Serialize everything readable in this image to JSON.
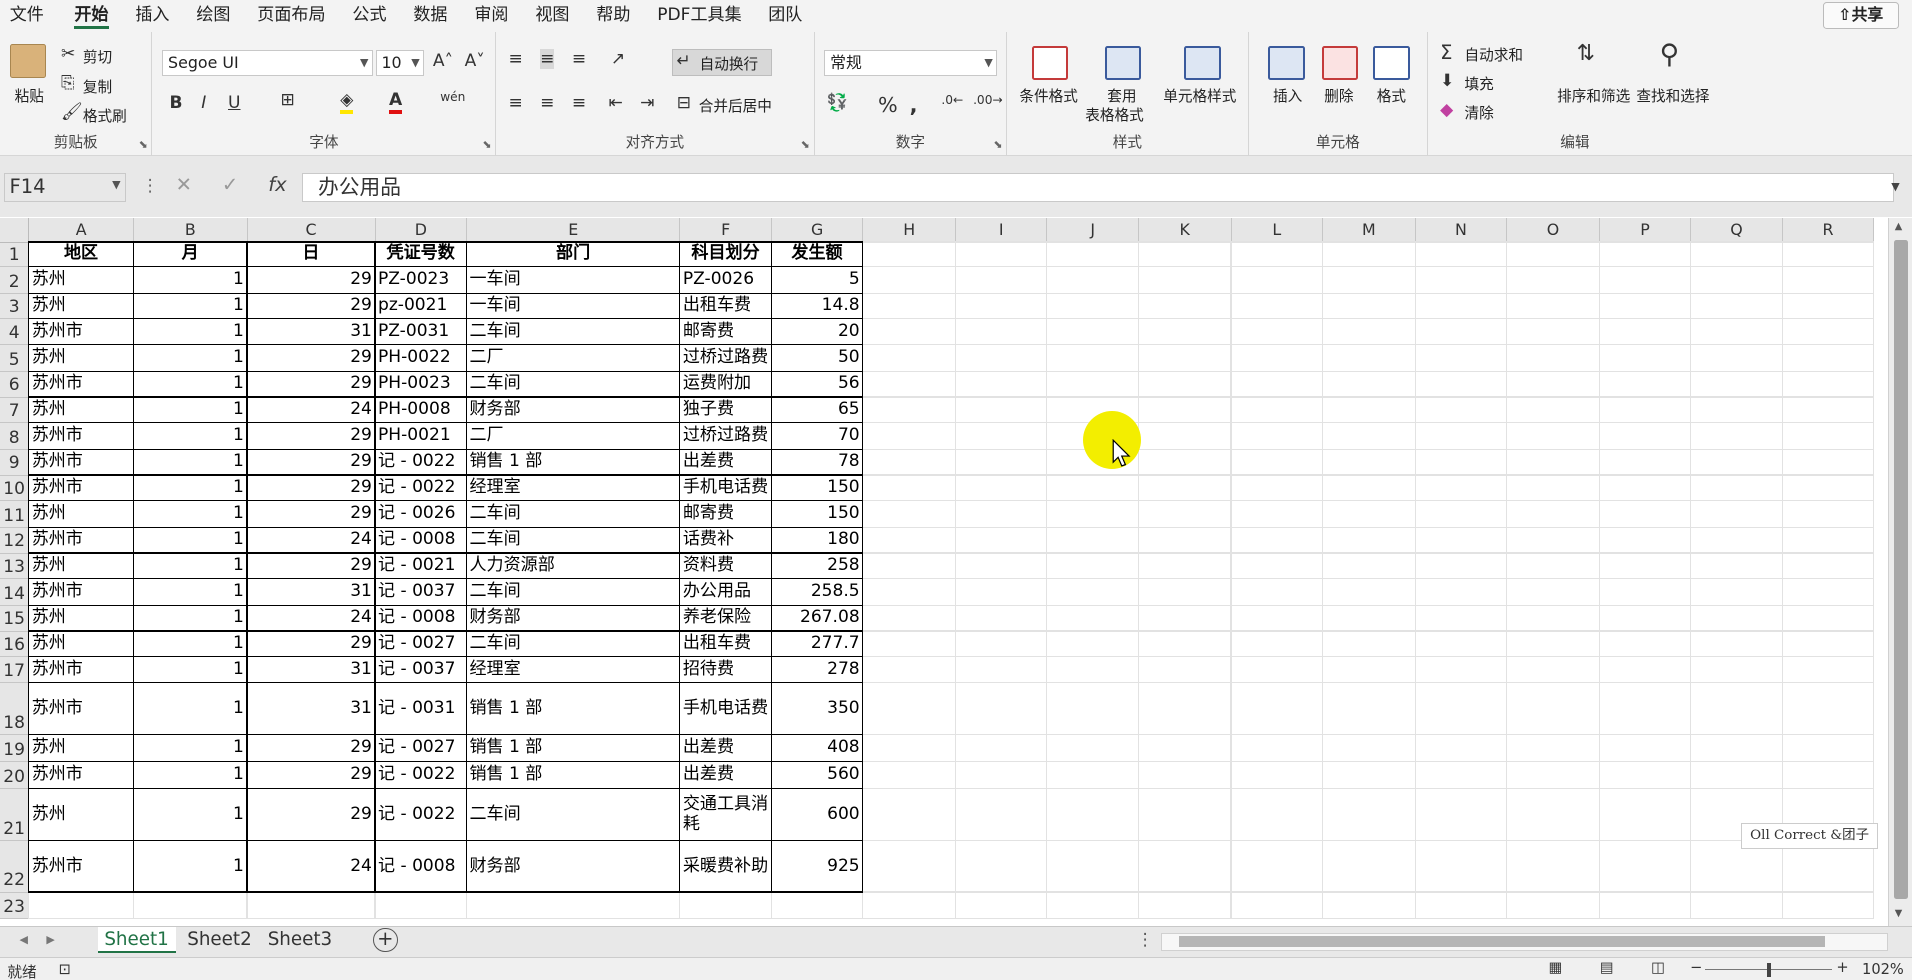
{
  "menu": {
    "tabs": [
      "文件",
      "开始",
      "插入",
      "绘图",
      "页面布局",
      "公式",
      "数据",
      "审阅",
      "视图",
      "帮助",
      "PDF工具集",
      "团队"
    ],
    "active": "开始",
    "share": "共享"
  },
  "ribbon": {
    "clipboard": {
      "paste": "粘贴",
      "cut": "剪切",
      "copy": "复制",
      "format_painter": "格式刷",
      "label": "剪贴板"
    },
    "font": {
      "name": "Segoe UI",
      "size": "10",
      "label": "字体"
    },
    "align": {
      "wrap": "自动换行",
      "merge": "合并后居中",
      "label": "对齐方式"
    },
    "number": {
      "format": "常规",
      "label": "数字"
    },
    "styles": {
      "cond": "条件格式",
      "table1": "套用",
      "table2": "表格格式",
      "cell": "单元格样式",
      "label": "样式"
    },
    "cells": {
      "insert": "插入",
      "delete": "删除",
      "format": "格式",
      "label": "单元格"
    },
    "editing": {
      "autosum": "自动求和",
      "fill": "填充",
      "clear": "清除",
      "sort": "排序和筛选",
      "find": "查找和选择",
      "label": "编辑"
    }
  },
  "formula_bar": {
    "name_box": "F14",
    "content": "办公用品"
  },
  "columns": [
    "A",
    "B",
    "C",
    "D",
    "E",
    "F",
    "G",
    "H",
    "I",
    "J",
    "K",
    "L",
    "M",
    "N",
    "O",
    "P",
    "Q",
    "R"
  ],
  "rows": [
    [
      "地区",
      "月",
      "日",
      "凭证号数",
      "部门",
      "科目划分",
      "发生额"
    ],
    [
      "苏州",
      "1",
      "29",
      "PZ-0023",
      "一车间",
      "PZ-0026",
      "5"
    ],
    [
      "苏州",
      "1",
      "29",
      "pz-0021",
      "一车间",
      "出租车费",
      "14.8"
    ],
    [
      "苏州市",
      "1",
      "31",
      "PZ-0031",
      "二车间",
      "邮寄费",
      "20"
    ],
    [
      "苏州",
      "1",
      "29",
      "PH-0022",
      "二厂",
      "过桥过路费",
      "50"
    ],
    [
      "苏州市",
      "1",
      "29",
      "PH-0023",
      "二车间",
      "运费附加",
      "56"
    ],
    [
      "苏州",
      "1",
      "24",
      "PH-0008",
      "财务部",
      "独子费",
      "65"
    ],
    [
      "苏州市",
      "1",
      "29",
      "PH-0021",
      "二厂",
      "过桥过路费",
      "70"
    ],
    [
      "苏州市",
      "1",
      "29",
      "记 - 0022",
      "销售 1 部",
      "出差费",
      "78"
    ],
    [
      "苏州市",
      "1",
      "29",
      "记 - 0022",
      "经理室",
      "手机电话费",
      "150"
    ],
    [
      "苏州",
      "1",
      "29",
      "记 - 0026",
      "二车间",
      "邮寄费",
      "150"
    ],
    [
      "苏州市",
      "1",
      "24",
      "记 - 0008",
      "二车间",
      "话费补",
      "180"
    ],
    [
      "苏州",
      "1",
      "29",
      "记 - 0021",
      "人力资源部",
      "资料费",
      "258"
    ],
    [
      "苏州市",
      "1",
      "31",
      "记 - 0037",
      "二车间",
      "办公用品",
      "258.5"
    ],
    [
      "苏州",
      "1",
      "24",
      "记 - 0008",
      "财务部",
      "养老保险",
      "267.08"
    ],
    [
      "苏州",
      "1",
      "29",
      "记 - 0027",
      "二车间",
      "出租车费",
      "277.7"
    ],
    [
      "苏州市",
      "1",
      "31",
      "记 - 0037",
      "经理室",
      "招待费",
      "278"
    ],
    [
      "苏州市",
      "1",
      "31",
      "记 - 0031",
      "销售 1 部",
      "手机电话费",
      "350"
    ],
    [
      "苏州",
      "1",
      "29",
      "记 - 0027",
      "销售 1 部",
      "出差费",
      "408"
    ],
    [
      "苏州市",
      "1",
      "29",
      "记 - 0022",
      "销售 1 部",
      "出差费",
      "560"
    ],
    [
      "苏州",
      "1",
      "29",
      "记 - 0022",
      "二车间",
      "交通工具消耗",
      "600"
    ],
    [
      "苏州市",
      "1",
      "24",
      "记 - 0008",
      "财务部",
      "采暖费补助",
      "925"
    ]
  ],
  "sheets": [
    "Sheet1",
    "Sheet2",
    "Sheet3"
  ],
  "active_sheet": "Sheet1",
  "status": {
    "ready": "就绪",
    "zoom": "102%"
  },
  "watermark": "Oll Correct &团子",
  "colors": {
    "accent": "#217346",
    "cursor_highlight": "#f3ee00"
  }
}
